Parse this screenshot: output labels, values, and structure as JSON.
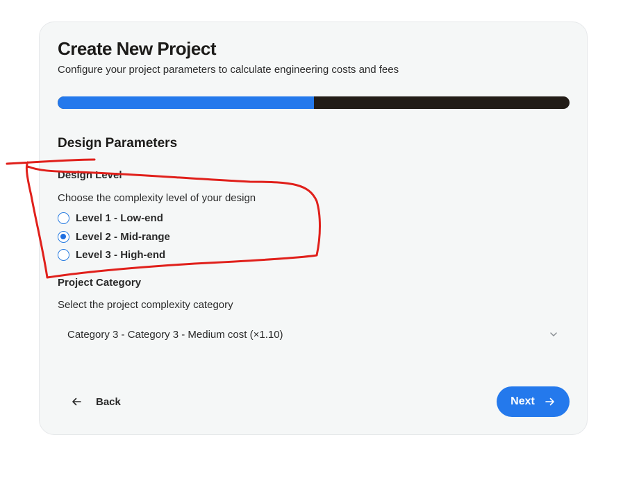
{
  "header": {
    "title": "Create New Project",
    "subtitle": "Configure your project parameters to calculate engineering costs and fees"
  },
  "progress": {
    "fraction": 0.5
  },
  "section": {
    "title": "Design Parameters"
  },
  "design_level": {
    "label": "Design Level",
    "description": "Choose the complexity level of your design",
    "options": [
      {
        "label": "Level 1 - Low-end",
        "selected": false
      },
      {
        "label": "Level 2 - Mid-range",
        "selected": true
      },
      {
        "label": "Level 3 - High-end",
        "selected": false
      }
    ]
  },
  "project_category": {
    "label": "Project Category",
    "description": "Select the project complexity category",
    "selected_value": "Category 3 - Category 3 - Medium cost (×1.10)",
    "icon": "chevron-down-icon"
  },
  "footer": {
    "back_label": "Back",
    "back_icon": "arrow-left-icon",
    "next_label": "Next",
    "next_icon": "arrow-right-icon"
  },
  "colors": {
    "accent": "#2479ec",
    "progress_track": "#221c17",
    "annotation": "#e0201b"
  }
}
